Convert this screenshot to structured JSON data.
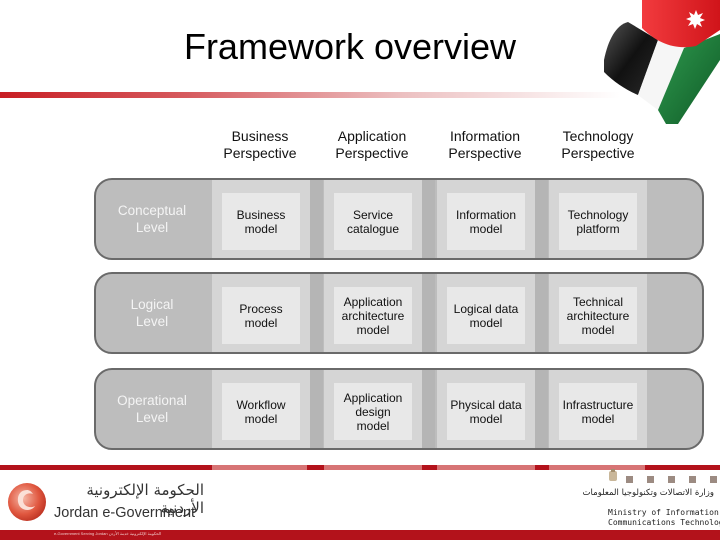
{
  "title": "Framework overview",
  "columns": [
    {
      "label": "Business Perspective",
      "line1": "Business",
      "line2": "Perspective"
    },
    {
      "label": "Application Perspective",
      "line1": "Application",
      "line2": "Perspective"
    },
    {
      "label": "Information Perspective",
      "line1": "Information",
      "line2": "Perspective"
    },
    {
      "label": "Technology Perspective",
      "line1": "Technology",
      "line2": "Perspective"
    }
  ],
  "rows": [
    {
      "level": [
        "Conceptual",
        "Level"
      ],
      "cells": [
        [
          "Business",
          "model"
        ],
        [
          "Service",
          "catalogue"
        ],
        [
          "Information",
          "model"
        ],
        [
          "Technology",
          "platform"
        ]
      ]
    },
    {
      "level": [
        "Logical",
        "Level"
      ],
      "cells": [
        [
          "Process",
          "model"
        ],
        [
          "Application",
          "architecture",
          "model"
        ],
        [
          "Logical data",
          "model"
        ],
        [
          "Technical",
          "architecture",
          "model"
        ]
      ]
    },
    {
      "level": [
        "Operational",
        "Level"
      ],
      "cells": [
        [
          "Workflow",
          "model"
        ],
        [
          "Application",
          "design",
          "model"
        ],
        [
          "Physical data",
          "model"
        ],
        [
          "Infrastructure",
          "model"
        ]
      ]
    }
  ],
  "footer": {
    "left_logo_arabic": "الحكومة الإلكترونية الأردنية",
    "left_logo_english": "Jordan e-Government",
    "strip_text": "e-Government Serving Jordan  الحكومة الإلكترونية خدمة الأردن",
    "ministry_arabic": "وزارة الاتصالات وتكنولوجيا المعلومات",
    "ministry_english_line1": "Ministry of Information and",
    "ministry_english_line2": "Communications Technology"
  },
  "colors": {
    "accent_red": "#b3121b",
    "row_dark": "#bdbdbd",
    "row_band": "#d5d5d5",
    "cell": "#e8e8e8",
    "flag_red": "#e4191f",
    "flag_green": "#1f7a3a",
    "flag_black": "#1a1a1a"
  }
}
